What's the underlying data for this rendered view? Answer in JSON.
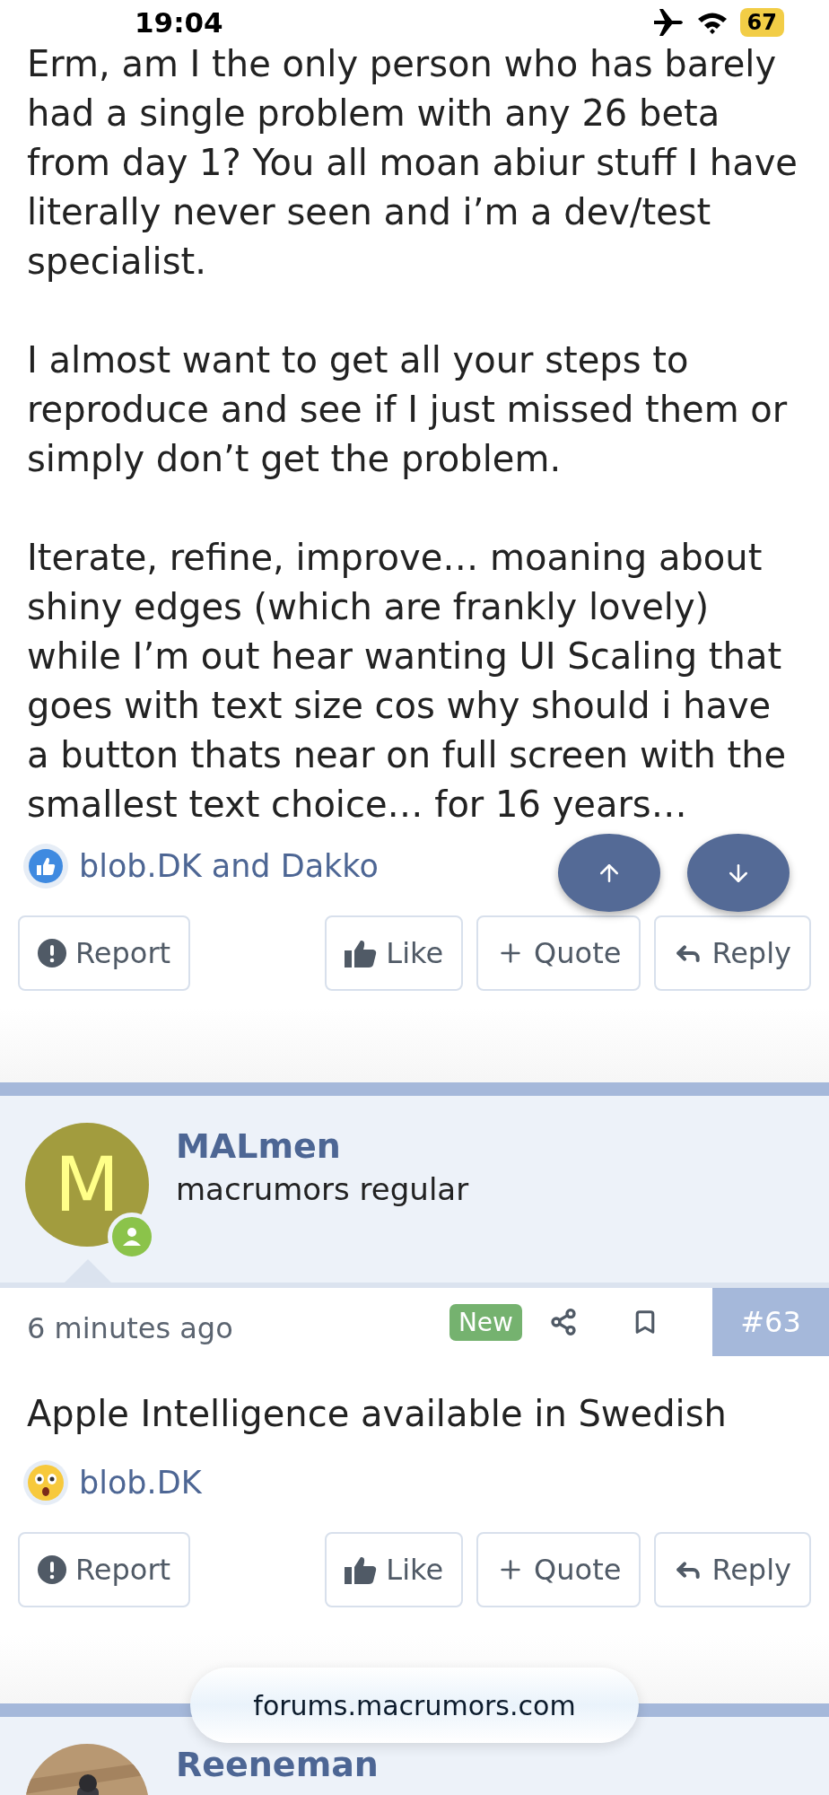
{
  "status_bar": {
    "time": "19:04",
    "battery": "67"
  },
  "posts": [
    {
      "paragraphs": [
        "Erm, am I the only person who has barely had a single problem with any 26 beta from day 1? You all moan abiur stuff I have literally never seen and i’m a dev/test specialist.",
        "I almost want to get all your steps to reproduce and see if I just missed them or simply don’t get the problem.",
        "Iterate, refine, improve… moaning about shiny edges (which are frankly lovely) while I’m out hear wanting UI Scaling that goes with text size cos why should i have a button thats near on full screen with the smallest text choice… for 16 years…"
      ],
      "reaction": {
        "kind": "like",
        "text": "blob.DK and Dakko"
      },
      "actions": [
        {
          "kind": "report",
          "label": "Report"
        },
        {
          "kind": "like",
          "label": "Like"
        },
        {
          "kind": "quote",
          "label": "Quote"
        },
        {
          "kind": "reply",
          "label": "Reply"
        }
      ]
    },
    {
      "author": {
        "name": "MALmen",
        "title": "macrumors regular",
        "avatar": {
          "kind": "letter",
          "initial": "M"
        }
      },
      "time": "6 minutes ago",
      "badge": "New",
      "number": "#63",
      "paragraphs": [
        "Apple Intelligence available in Swedish"
      ],
      "reaction": {
        "kind": "wow",
        "text": "blob.DK"
      },
      "actions": [
        {
          "kind": "report",
          "label": "Report"
        },
        {
          "kind": "like",
          "label": "Like"
        },
        {
          "kind": "quote",
          "label": "Quote"
        },
        {
          "kind": "reply",
          "label": "Reply"
        }
      ]
    },
    {
      "author": {
        "name": "Reeneman"
      }
    }
  ],
  "scroll_buttons": [
    {
      "kind": "up"
    },
    {
      "kind": "down"
    }
  ],
  "url_bar": {
    "text": "forums.macrumors.com"
  }
}
